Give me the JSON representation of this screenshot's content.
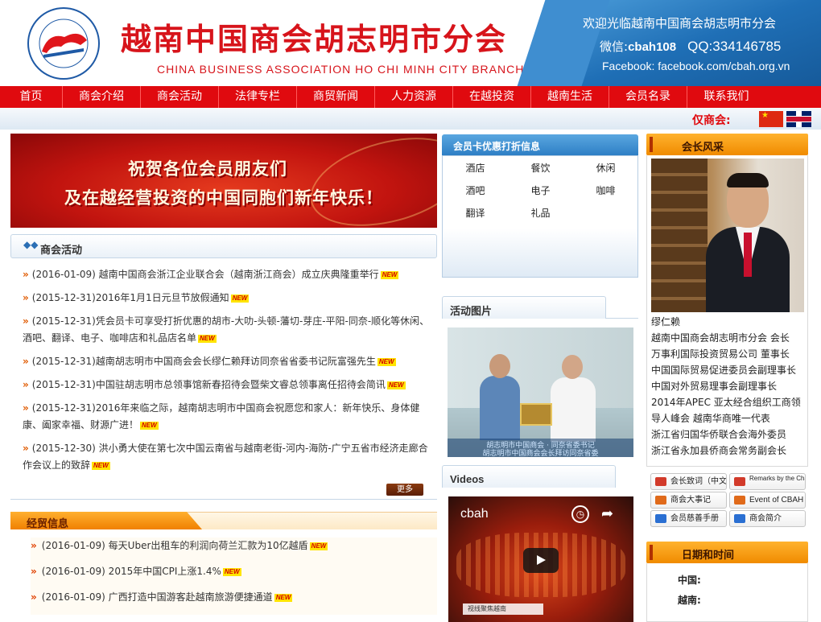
{
  "header": {
    "title": "越南中国商会胡志明市分会",
    "subtitle": "CHINA BUSINESS ASSOCIATION HO CHI MINH CITY BRANCH",
    "welcome": "欢迎光临越南中国商会胡志明市分会",
    "wechat_label": "微信:",
    "wechat_id": "cbah108",
    "qq": "QQ:334146785",
    "facebook": "Facebook: facebook.com/cbah.org.vn",
    "logo_text": "胡志明市中国商会"
  },
  "nav": {
    "items": [
      "首页",
      "商会介绍",
      "商会活动",
      "法律专栏",
      "商贸新闻",
      "人力资源",
      "在越投资",
      "越南生活",
      "会员名录",
      "联系我们"
    ]
  },
  "lang_bar": {
    "label": "仅商会:"
  },
  "banner": {
    "line1": "祝贺各位会员朋友们",
    "line2": "及在越经营投资的中国同胞们新年快乐！"
  },
  "activities": {
    "title": "商会活动",
    "items": [
      "(2016-01-09) 越南中国商会浙江企业联合会（越南浙江商会）成立庆典隆重举行",
      "(2015-12-31)2016年1月1日元旦节放假通知",
      "(2015-12-31)凭会员卡可享受打折优惠的胡市-大叻-头顿-藩切-芽庄-平阳-同奈-顺化等休闲、酒吧、翻译、电子、咖啡店和礼品店名单",
      "(2015-12-31)越南胡志明市中国商会会长缪仁赖拜访同奈省省委书记阮富强先生",
      "(2015-12-31)中国驻胡志明市总领事馆新春招待会暨柴文睿总领事离任招待会简讯",
      "(2015-12-31)2016年来临之际，越南胡志明市中国商会祝愿您和家人：新年快乐、身体健康、阖家幸福、财源广进！",
      "(2015-12-30) 洪小勇大使在第七次中国云南省与越南老街-河内-海防-广宁五省市经济走廊合作会议上的致辞"
    ],
    "new_badge": "NEW",
    "more_label": "更多"
  },
  "trade": {
    "title": "经贸信息",
    "items": [
      "(2016-01-09) 每天Uber出租车的利润向荷兰汇款为10亿越盾",
      "(2016-01-09) 2015年中国CPI上涨1.4%",
      "(2016-01-09) 广西打造中国游客赴越南旅游便捷通道"
    ]
  },
  "member_card": {
    "title": "会员卡优惠打折信息",
    "cells": [
      "酒店",
      "餐饮",
      "休闲",
      "酒吧",
      "电子",
      "咖啡",
      "翻译",
      "礼品"
    ]
  },
  "photos": {
    "title": "活动图片",
    "caption_line1": "胡志明市中国商会 · 同奈省委书记",
    "caption_line2": "胡志明市中国商会会长拜访同奈省委"
  },
  "videos": {
    "title": "Videos",
    "channel": "cbah",
    "strip": "视线聚焦越南"
  },
  "chairman": {
    "title": "会长风采",
    "name": "缪仁赖",
    "lines": [
      "越南中国商会胡志明市分会 会长",
      "万事利国际投资贸易公司 董事长",
      "中国国际贸易促进委员会副理事长",
      "中国对外贸易理事会副理事长",
      "2014年APEC 亚太经合组织工商领",
      "导人峰会 越南华商唯一代表",
      "浙江省归国华侨联合会海外委员",
      "浙江省永加县侨商会常务副会长"
    ],
    "links": [
      "会长致词（中文）",
      "Remarks by the Chairperson",
      "商会大事记",
      "Event of CBAH",
      "会员慈善手册",
      "商会简介"
    ]
  },
  "date": {
    "title": "日期和时间",
    "china_label": "中国:",
    "vietnam_label": "越南:"
  },
  "colors": {
    "brand_red": "#e00a0f",
    "header_blue": "#1f6fb6",
    "accent_orange": "#f08b00"
  }
}
